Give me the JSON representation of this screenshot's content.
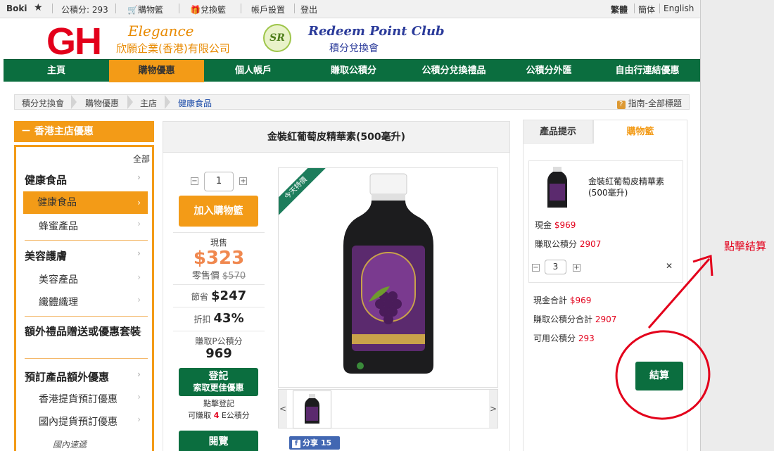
{
  "topbar": {
    "user": "Boki",
    "points": "公積分: 293",
    "cart": "購物籃",
    "exchange": "兌換籃",
    "account": "帳戶設置",
    "logout": "登出",
    "lang_trad": "繁體",
    "lang_simp": "簡体",
    "lang_en": "English"
  },
  "header": {
    "logo_gh": "GH",
    "elegance": "Elegance",
    "company": "欣願企業(香港)有限公司",
    "sr": "SR",
    "redeem_club": "Redeem Point Club",
    "points_club": "積分兌換會"
  },
  "nav": [
    "主頁",
    "購物優惠",
    "個人帳戶",
    "賺取公積分",
    "公積分兌換禮品",
    "公積分外匯",
    "自由行連結優惠"
  ],
  "breadcrumb": [
    "積分兌換會",
    "購物優惠",
    "主店",
    "健康食品"
  ],
  "guide": "指南-全部標題",
  "sidebar": {
    "heading": "－ 香港主店優惠",
    "all": "全部",
    "items": [
      {
        "label": "健康食品"
      },
      {
        "label": "健康食品"
      },
      {
        "label": "蜂蜜產品"
      },
      {
        "label": "美容護膚"
      },
      {
        "label": "美容產品"
      },
      {
        "label": "纖體纖理"
      },
      {
        "label": "額外禮品贈送或優惠套裝"
      },
      {
        "label": "預訂產品額外優惠"
      },
      {
        "label": "香港提貨預訂優惠"
      },
      {
        "label": "國內提貨預訂優惠"
      },
      {
        "label": "國內速遞"
      }
    ]
  },
  "product": {
    "title": "金裝紅葡萄皮精華素(500毫升)",
    "qty": "1",
    "add_cart": "加入購物籃",
    "now_label": "現售",
    "price": "$323",
    "retail_label": "零售價",
    "retail_price": "$570",
    "save_label": "節省",
    "save": "$247",
    "discount_label": "折扣",
    "discount": "43%",
    "earn_label": "賺取P公積分",
    "earn": "969",
    "reg_line1": "登記",
    "reg_line2": "索取更佳優惠",
    "reg_note1": "點擊登記",
    "reg_note2a": "可賺取",
    "reg_note2b": "4",
    "reg_note2c": "E公積分",
    "browse": "閱覽",
    "ribbon": "今天特價",
    "fb_share": "分享 15"
  },
  "cart_panel": {
    "tab_info": "產品提示",
    "tab_cart": "購物籃",
    "item_name": "金裝紅葡萄皮精華素(500毫升)",
    "cash_label": "現金",
    "cash": "$969",
    "earn_label": "賺取公積分",
    "earn": "2907",
    "qty": "3",
    "total_cash_label": "現金合計",
    "total_cash": "$969",
    "total_earn_label": "賺取公積分合計",
    "total_earn": "2907",
    "avail_label": "可用公積分",
    "avail": "293",
    "checkout": "結算"
  },
  "annotation": "點擊結算",
  "colors": {
    "nav_green": "#0b6e3f",
    "accent_orange": "#f39b17",
    "price": "#f0884f",
    "annotation_red": "#e3001b"
  }
}
